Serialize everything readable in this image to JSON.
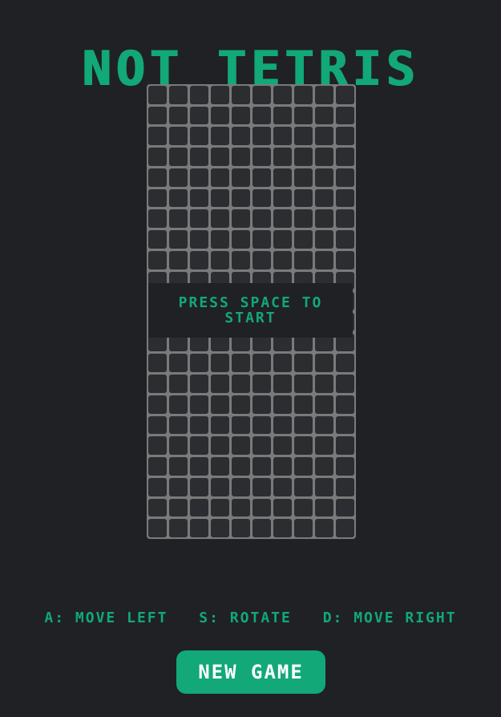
{
  "game": {
    "title": "NOT TETRIS",
    "board": {
      "columns": 10,
      "rows": 22
    },
    "overlay_text": "PRESS SPACE TO START"
  },
  "controls": [
    {
      "label": "A: MOVE LEFT"
    },
    {
      "label": "S: ROTATE"
    },
    {
      "label": "D: MOVE RIGHT"
    }
  ],
  "new_game_label": "NEW GAME",
  "colors": {
    "accent": "#12a878",
    "background": "#202124",
    "cell": "#2c2d30",
    "grid_line": "#7a7a7a",
    "button_text": "#ffffff"
  }
}
